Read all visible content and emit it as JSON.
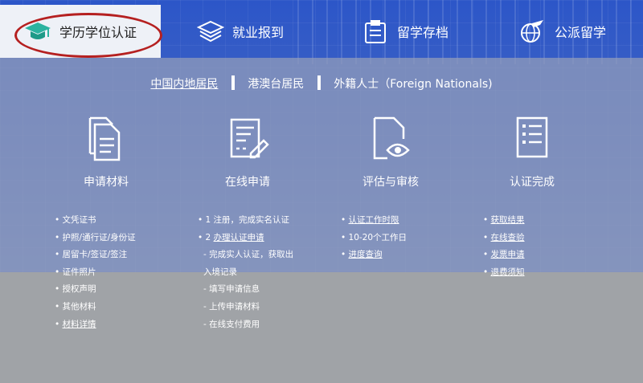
{
  "tabs": [
    {
      "label": "学历学位认证",
      "icon": "graduation-cap-icon",
      "active": true
    },
    {
      "label": "就业报到",
      "icon": "cap-layers-icon",
      "active": false
    },
    {
      "label": "留学存档",
      "icon": "folder-archive-icon",
      "active": false
    },
    {
      "label": "公派留学",
      "icon": "plane-globe-icon",
      "active": false
    }
  ],
  "regions": [
    "中国内地居民",
    "港澳台居民",
    "外籍人士（Foreign Nationals)"
  ],
  "steps": [
    {
      "title": "申请材料",
      "icon": "documents-icon"
    },
    {
      "title": "在线申请",
      "icon": "form-edit-icon"
    },
    {
      "title": "评估与审核",
      "icon": "document-eye-icon"
    },
    {
      "title": "认证完成",
      "icon": "checklist-icon"
    }
  ],
  "materials": [
    "文凭证书",
    "护照/通行证/身份证",
    "居留卡/签证/签注",
    "证件照片",
    "授权声明",
    "其他材料",
    "材料详情"
  ],
  "apply": {
    "step1": "1 注册，完成实名认证",
    "step2_prefix": "2 ",
    "step2_link": "办理认证申请",
    "sub1a": "- 完成实人认证，获取出",
    "sub1b": "入境记录",
    "sub2": "- 填写申请信息",
    "sub3": "- 上传申请材料",
    "sub4": "- 在线支付费用"
  },
  "review": [
    "认证工作时限",
    "10-20个工作日",
    "进度查询"
  ],
  "complete": [
    "获取结果",
    "在线查验",
    "发票申请",
    "退费须知"
  ],
  "colors": {
    "accent": "#2c56c8",
    "ring": "#b52020",
    "tab_active_bg": "#eef1f7"
  }
}
